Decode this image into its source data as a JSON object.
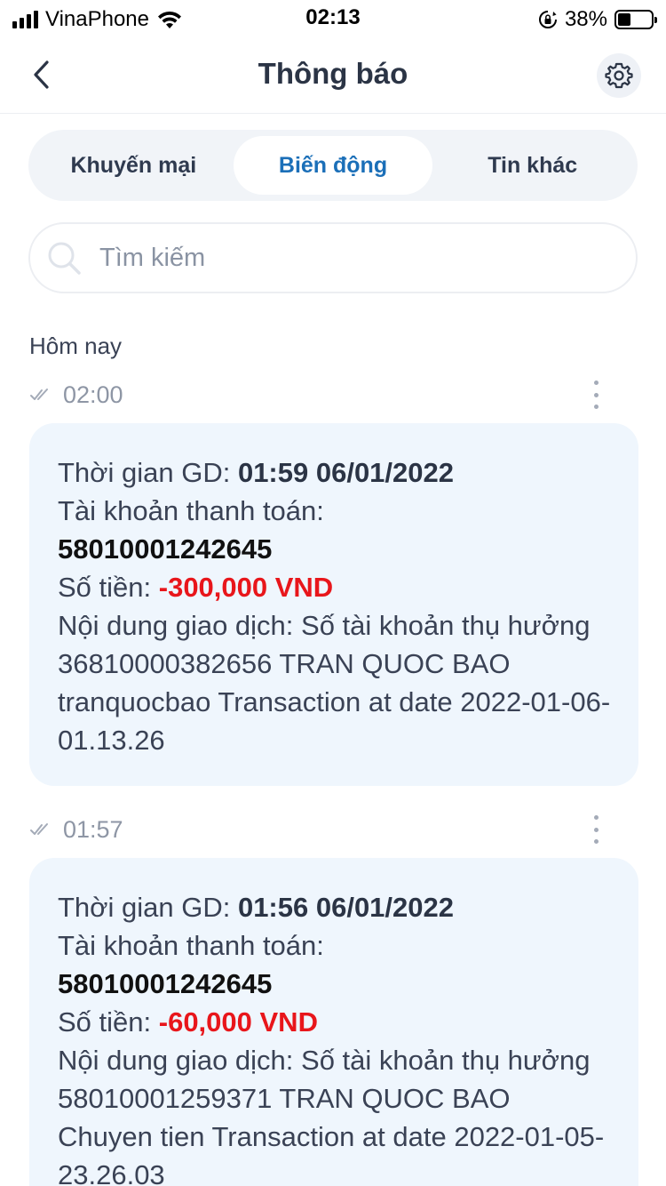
{
  "status_bar": {
    "carrier": "VinaPhone",
    "time": "02:13",
    "battery": "38%",
    "battery_level": 0.38
  },
  "header": {
    "title": "Thông báo"
  },
  "tabs": [
    {
      "label": "Khuyến mại",
      "active": false
    },
    {
      "label": "Biến động",
      "active": true
    },
    {
      "label": "Tin khác",
      "active": false
    }
  ],
  "search": {
    "placeholder": "Tìm kiếm"
  },
  "section": {
    "label": "Hôm nay"
  },
  "notifications": [
    {
      "time": "02:00",
      "time_label": "Thời gian GD: ",
      "time_value": "01:59 06/01/2022",
      "account_label": "Tài khoản thanh toán:",
      "account_value": "58010001242645",
      "amount_label": "Số tiền: ",
      "amount_value": "-300,000 VND",
      "content": "Nội dung giao dịch: Số tài khoản thụ hưởng 36810000382656 TRAN QUOC BAO tranquocbao Transaction at date 2022-01-06-01.13.26"
    },
    {
      "time": "01:57",
      "time_label": "Thời gian GD: ",
      "time_value": "01:56 06/01/2022",
      "account_label": "Tài khoản thanh toán:",
      "account_value": "58010001242645",
      "amount_label": "Số tiền: ",
      "amount_value": "-60,000 VND",
      "content": "Nội dung giao dịch: Số tài khoản thụ hưởng 58010001259371 TRAN QUOC BAO Chuyen tien Transaction at date 2022-01-05-23.26.03"
    }
  ],
  "colors": {
    "accent": "#1b6fb8",
    "negative_amount": "#e8161b",
    "card_background": "#eff6fd"
  }
}
